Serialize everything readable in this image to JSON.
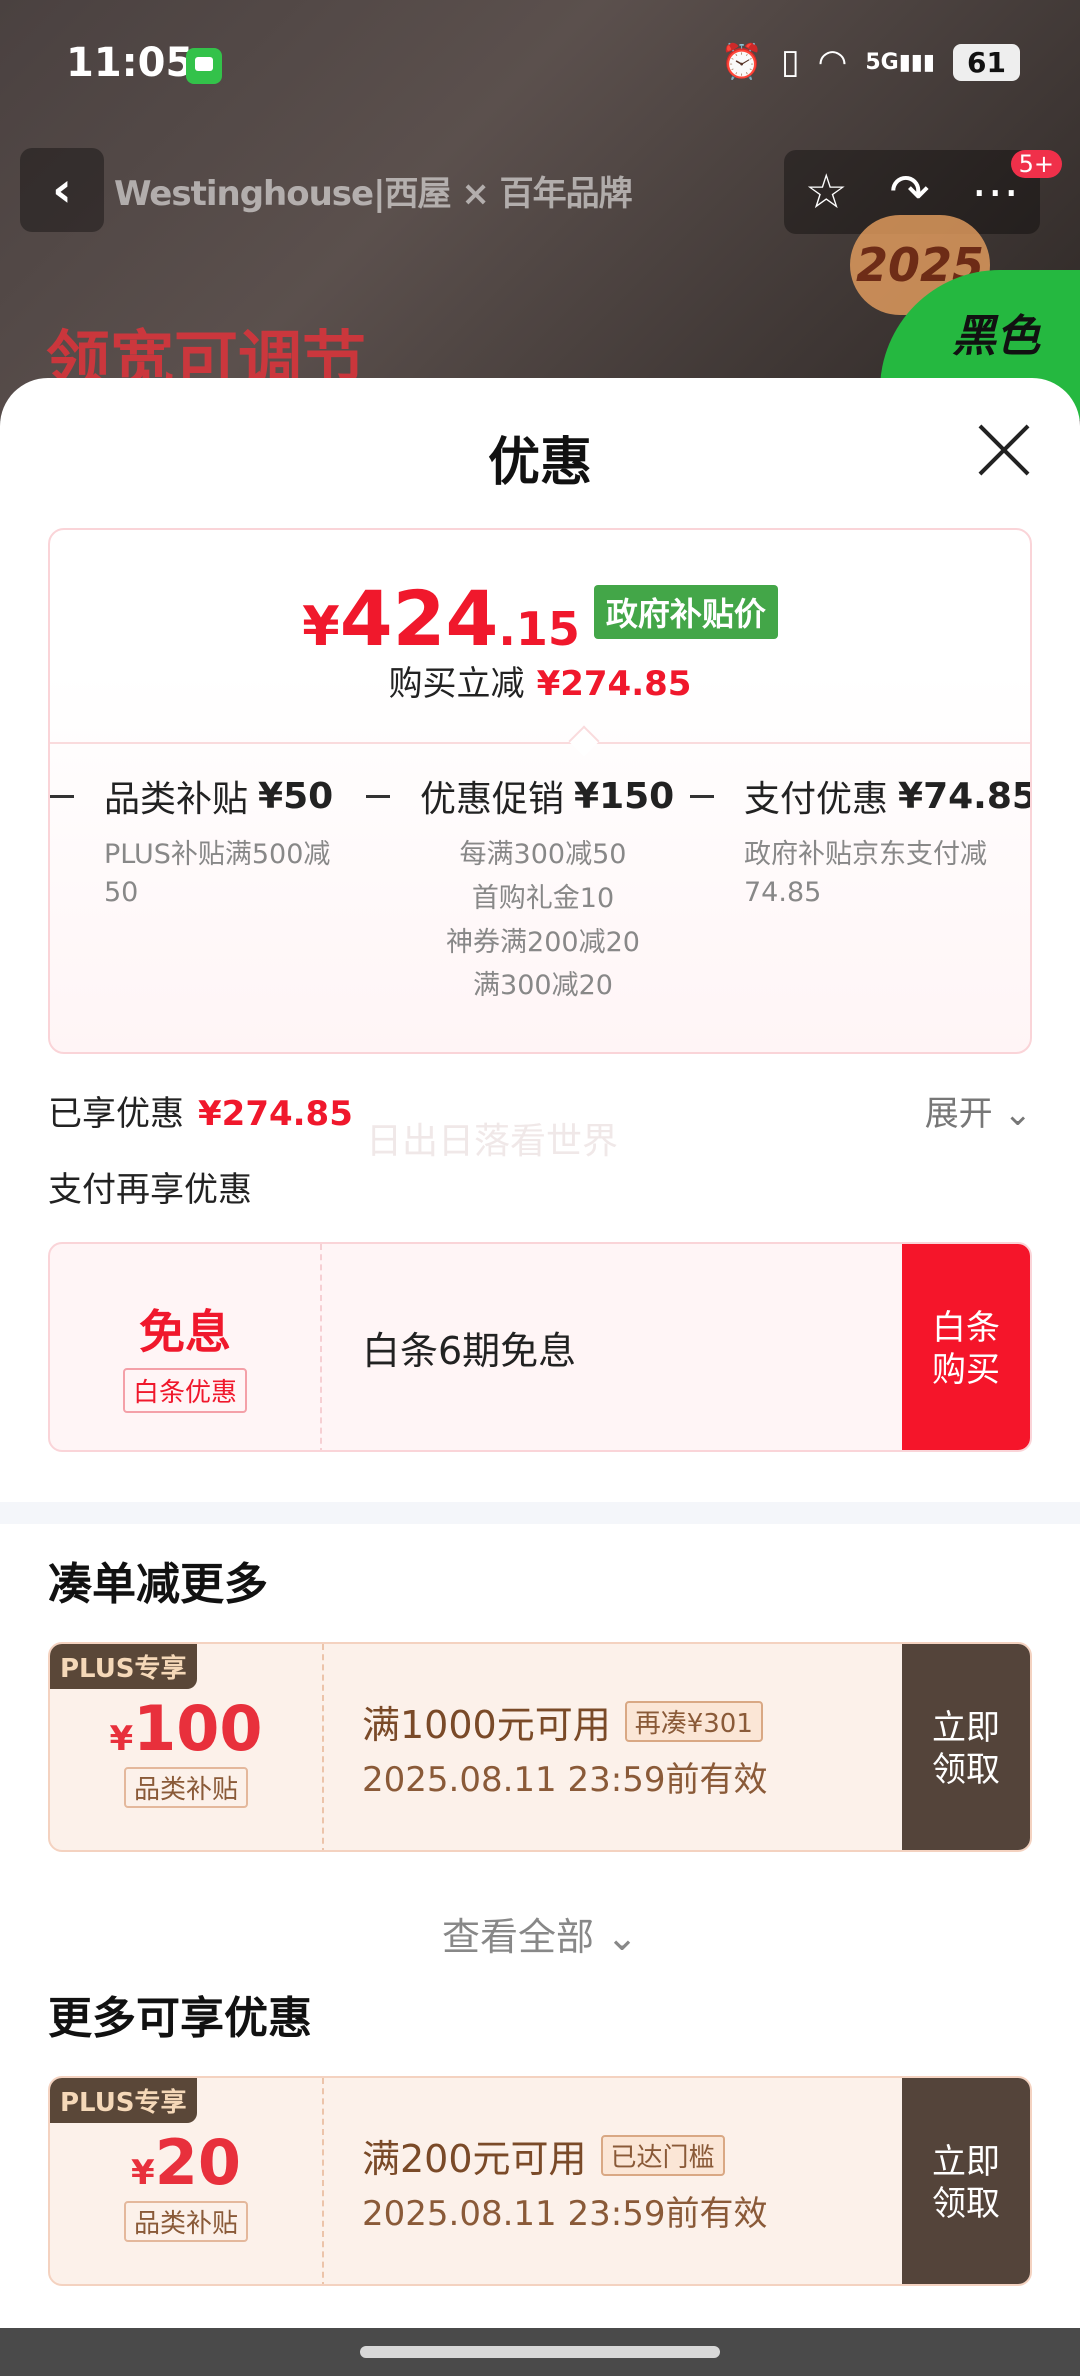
{
  "status_bar": {
    "time": "11:05",
    "network": "5G",
    "battery": "61"
  },
  "background": {
    "brand": "Westinghouse|西屋 × 百年品牌",
    "slogan": "领宽可调节",
    "badge": "5+",
    "year_badge": "2025",
    "color_label": "黑色"
  },
  "sheet": {
    "title": "优惠",
    "price": {
      "currency": "¥",
      "integer": "424",
      "decimal": ".15",
      "tag": "政府补贴价"
    },
    "reduce": {
      "label": "购买立减",
      "amount": "¥274.85"
    },
    "discounts": [
      {
        "name": "品类补贴",
        "value": "¥50",
        "details": [
          "PLUS补贴满500减50"
        ]
      },
      {
        "name": "优惠促销",
        "value": "¥150",
        "details": [
          "每满300减50",
          "首购礼金10",
          "神券满200减20",
          "满300减20"
        ]
      },
      {
        "name": "支付优惠",
        "value": "¥74.85",
        "details": [
          "政府补贴京东支付减74.85"
        ]
      }
    ],
    "enjoyed": {
      "label": "已享优惠",
      "amount": "¥274.85",
      "expand": "展开"
    },
    "watermark": "日出日落看世界",
    "pay_more_title": "支付再享优惠",
    "baitiao": {
      "big": "免息",
      "small": "白条优惠",
      "desc": "白条6期免息",
      "button": "白条\n购买"
    },
    "bundle_title": "凑单减更多",
    "more_title": "更多可享优惠",
    "view_all": "查看全部",
    "coupons": [
      {
        "tag": "PLUS专享",
        "currency": "¥",
        "amount": "100",
        "type": "品类补贴",
        "condition": "满1000元可用",
        "status": "再凑¥301",
        "valid": "2025.08.11 23:59前有效",
        "button": "立即\n领取"
      },
      {
        "tag": "PLUS专享",
        "currency": "¥",
        "amount": "20",
        "type": "品类补贴",
        "condition": "满200元可用",
        "status": "已达门槛",
        "valid": "2025.08.11 23:59前有效",
        "button": "立即\n领取"
      }
    ]
  }
}
